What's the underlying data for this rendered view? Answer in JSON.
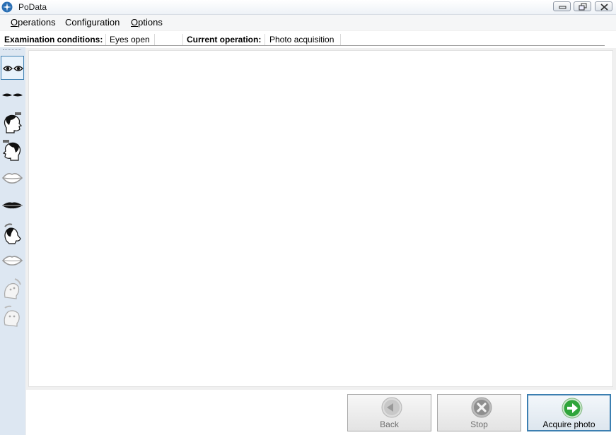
{
  "window": {
    "title": "PoData"
  },
  "menu": {
    "items": [
      "Operations",
      "Configuration",
      "Options"
    ]
  },
  "status": {
    "exam_label": "Examination conditions:",
    "exam_value": "Eyes open",
    "op_label": "Current operation:",
    "op_value": "Photo acquisition"
  },
  "sidebar": {
    "tools": [
      "eyes-open-icon",
      "eyes-closed-icon",
      "head-right-profile-icon",
      "head-left-profile-icon",
      "lips-open-icon",
      "lips-closed-icon",
      "head-tilt-icon",
      "lips-relaxed-icon",
      "face-disabled-icon",
      "face-disabled-2-icon"
    ],
    "selected_index": 0
  },
  "actions": {
    "back_label": "Back",
    "stop_label": "Stop",
    "acquire_label": "Acquire photo"
  },
  "colors": {
    "accent": "#3c7fb1",
    "go_green": "#2fa53a",
    "disabled_gray": "#9a9a9a"
  }
}
